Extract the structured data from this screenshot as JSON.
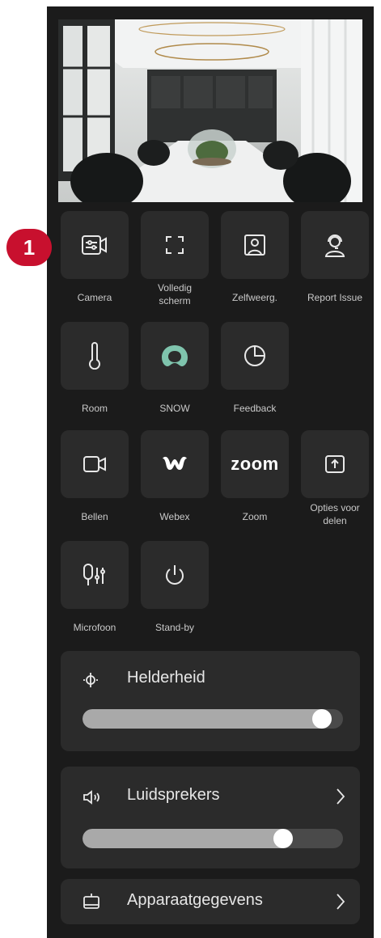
{
  "badge": "1",
  "tiles": [
    {
      "label": "Camera",
      "icon": "camera-settings-icon"
    },
    {
      "label": "Volledig\nscherm",
      "icon": "fullscreen-icon"
    },
    {
      "label": "Zelfweerg.",
      "icon": "selfview-icon"
    },
    {
      "label": "Report Issue",
      "icon": "headset-icon"
    },
    {
      "label": "Room",
      "icon": "thermometer-icon"
    },
    {
      "label": "SNOW",
      "icon": "snow-logo-icon"
    },
    {
      "label": "Feedback",
      "icon": "pie-chart-icon"
    },
    {
      "label": "Bellen",
      "icon": "video-call-icon"
    },
    {
      "label": "Webex",
      "icon": "webex-logo-icon"
    },
    {
      "label": "Zoom",
      "icon": "zoom-logo-icon",
      "logo_text": "zoom"
    },
    {
      "label": "Opties voor\ndelen",
      "icon": "share-icon"
    },
    {
      "label": "Microfoon",
      "icon": "microphone-settings-icon"
    },
    {
      "label": "Stand-by",
      "icon": "power-icon"
    }
  ],
  "brightness": {
    "label": "Helderheid",
    "level": 0.92,
    "icon": "brightness-icon"
  },
  "speakers": {
    "label": "Luidsprekers",
    "level": 0.77,
    "icon": "speaker-icon"
  },
  "device_info": {
    "label": "Apparaatgegevens",
    "icon": "device-icon"
  },
  "colors": {
    "panel": "#1b1b1b",
    "tile": "#2b2b2b",
    "badge": "#c8102e",
    "snow": "#7fc4ad"
  }
}
